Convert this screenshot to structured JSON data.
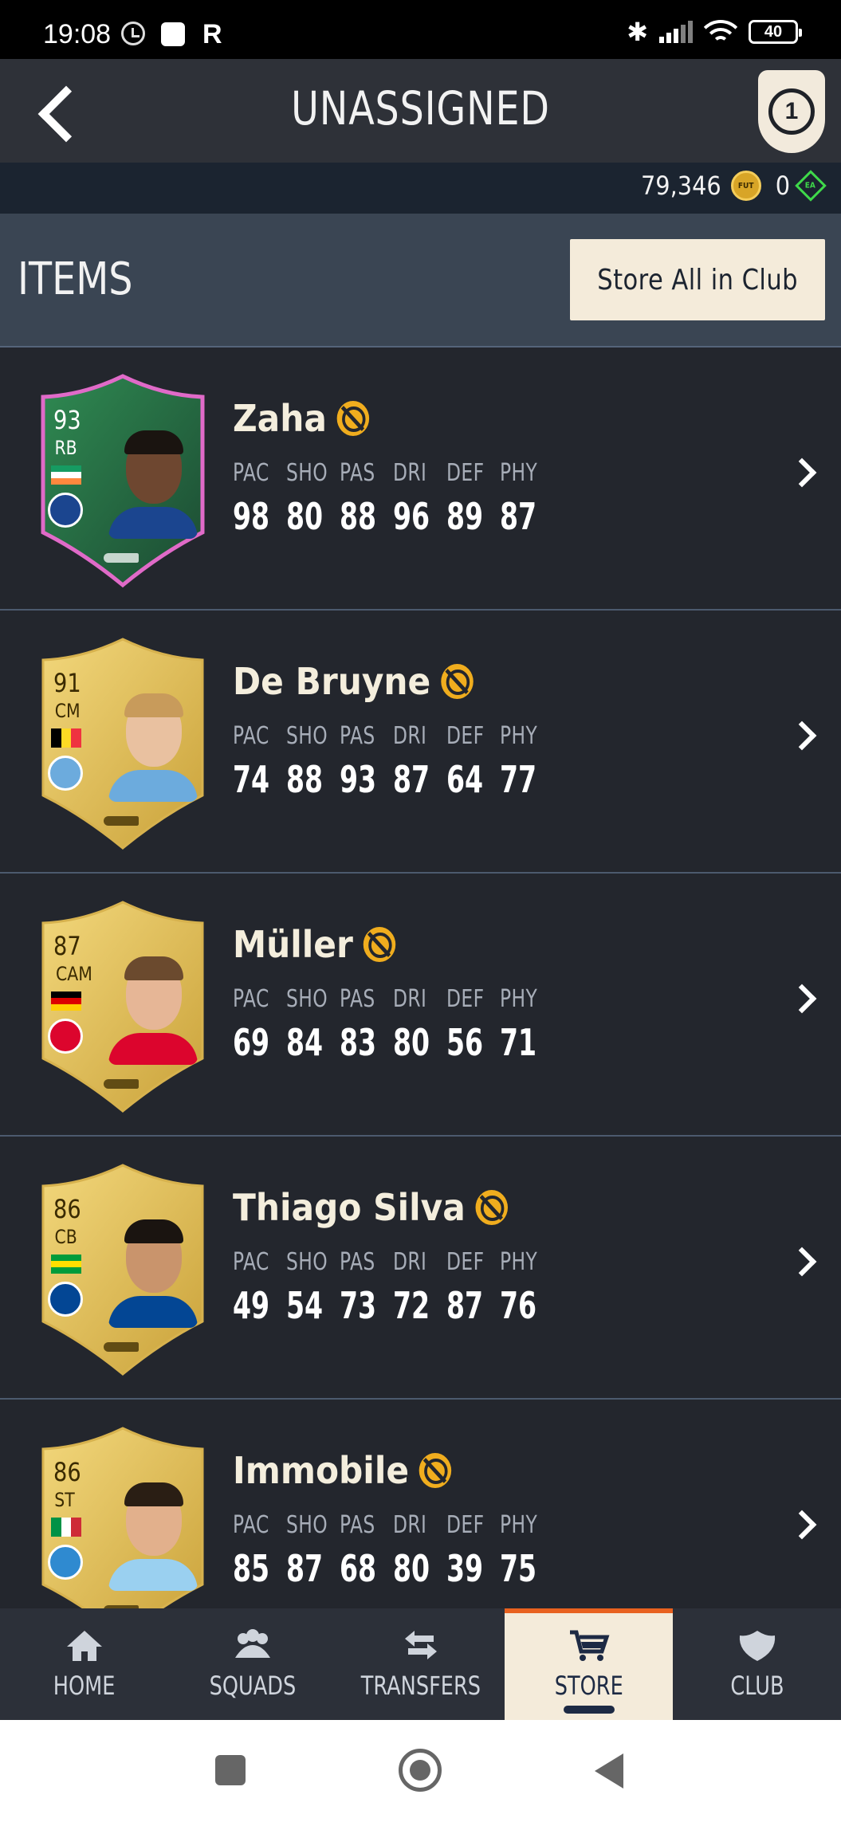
{
  "status_bar": {
    "time": "19:08",
    "r_label": "R",
    "battery": "40"
  },
  "header": {
    "title": "UNASSIGNED",
    "objective_count": "1"
  },
  "currency": {
    "coins": "79,346",
    "coin_icon_text": "FUT",
    "points": "0",
    "points_icon_text": "EA"
  },
  "items_section": {
    "title": "ITEMS",
    "store_all_label": "Store All in Club"
  },
  "stat_labels": [
    "PAC",
    "SHO",
    "PAS",
    "DRI",
    "DEF",
    "PHY"
  ],
  "players": [
    {
      "name": "Zaha",
      "rating": "93",
      "position": "RB",
      "card_type": "special",
      "stats": [
        "98",
        "80",
        "88",
        "96",
        "89",
        "87"
      ]
    },
    {
      "name": "De Bruyne",
      "rating": "91",
      "position": "CM",
      "card_type": "gold",
      "stats": [
        "74",
        "88",
        "93",
        "87",
        "64",
        "77"
      ]
    },
    {
      "name": "Müller",
      "rating": "87",
      "position": "CAM",
      "card_type": "gold",
      "stats": [
        "69",
        "84",
        "83",
        "80",
        "56",
        "71"
      ]
    },
    {
      "name": "Thiago Silva",
      "rating": "86",
      "position": "CB",
      "card_type": "gold",
      "stats": [
        "49",
        "54",
        "73",
        "72",
        "87",
        "76"
      ]
    },
    {
      "name": "Immobile",
      "rating": "86",
      "position": "ST",
      "card_type": "gold",
      "stats": [
        "85",
        "87",
        "68",
        "80",
        "39",
        "75"
      ]
    }
  ],
  "bottom_nav": [
    {
      "label": "HOME",
      "icon": "home-icon",
      "active": false
    },
    {
      "label": "SQUADS",
      "icon": "squads-icon",
      "active": false
    },
    {
      "label": "TRANSFERS",
      "icon": "transfers-icon",
      "active": false
    },
    {
      "label": "STORE",
      "icon": "cart-icon",
      "active": true
    },
    {
      "label": "CLUB",
      "icon": "club-icon",
      "active": false
    }
  ],
  "colors": {
    "accent": "#e8611f",
    "untradeable": "#f0ad1e",
    "gold_card": "#e6c35a",
    "special_card": "#3aa25a",
    "active_tab_bg": "#f4ebda"
  }
}
